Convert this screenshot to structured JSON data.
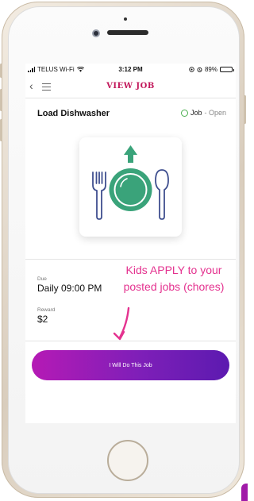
{
  "status_bar": {
    "carrier": "TELUS Wi-Fi",
    "time": "3:12 PM",
    "battery": "89%",
    "battery_level": 0.89
  },
  "nav": {
    "title": "VIEW JOB",
    "back_icon": "chevron-left-icon",
    "menu_icon": "hamburger-menu-icon"
  },
  "job": {
    "title": "Load Dishwasher",
    "status_label": "Job",
    "status_value": "- Open",
    "image_icon": "dish-upload-icon",
    "due_label": "Due",
    "due_value": "Daily 09:00 PM",
    "reward_label": "Reward",
    "reward_value": "$2"
  },
  "annotation": {
    "text": "Kids APPLY to your posted jobs (chores)"
  },
  "cta": {
    "label": "I Will Do This Job"
  },
  "colors": {
    "accent": "#c2185b",
    "annotation": "#e4328f",
    "plate": "#3aa37a",
    "cutlery": "#3f4f8f",
    "button_start": "#b51ab5",
    "button_end": "#5c1ab0",
    "status_open": "#4caf50"
  }
}
